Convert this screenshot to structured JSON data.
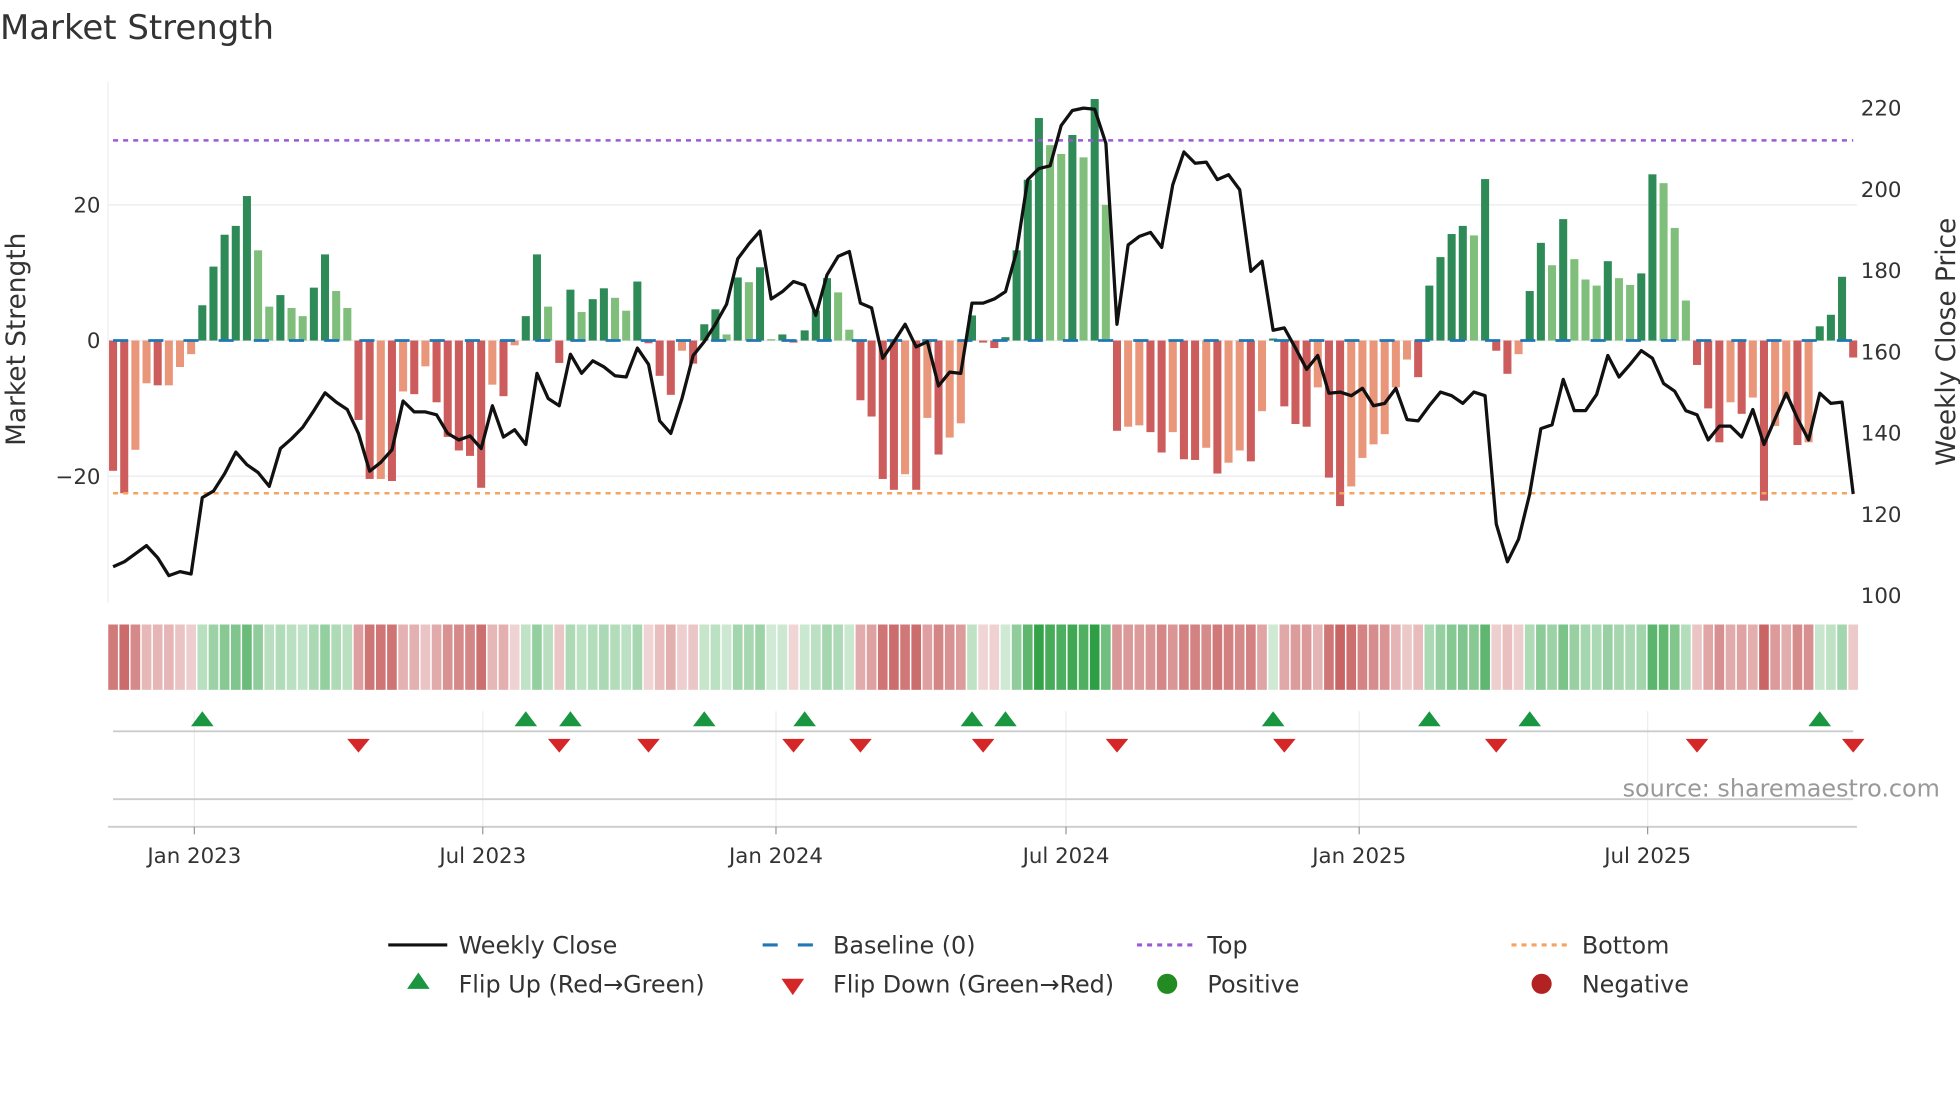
{
  "chart_data": {
    "type": "bar",
    "title": "Market Strength",
    "ylabel_left": "Market Strength",
    "ylabel_right": "Weekly Close Price",
    "source": "source: sharemaestro.com",
    "start_date": "2022-11-11",
    "frequency": "weekly",
    "left_axis": {
      "ticks": [
        20,
        0,
        -20
      ],
      "tick_labels": [
        "20",
        "0",
        "−20"
      ]
    },
    "right_axis": {
      "ticks": [
        220,
        200,
        180,
        160,
        140,
        120,
        100
      ],
      "tick_labels": [
        "220",
        "200",
        "180",
        "160",
        "140",
        "120",
        "100"
      ],
      "ylim": [
        100,
        220
      ]
    },
    "x_ticks": [
      {
        "date": "2023-01-01",
        "label": "Jan 2023"
      },
      {
        "date": "2023-07-01",
        "label": "Jul 2023"
      },
      {
        "date": "2024-01-01",
        "label": "Jan 2024"
      },
      {
        "date": "2024-07-01",
        "label": "Jul 2024"
      },
      {
        "date": "2025-01-01",
        "label": "Jan 2025"
      },
      {
        "date": "2025-07-01",
        "label": "Jul 2025"
      }
    ],
    "top_level": 29.5,
    "bottom_level": -22.5,
    "baseline": 0,
    "strength": [
      -19.2,
      -22.5,
      -16.1,
      -6.3,
      -6.6,
      -6.6,
      -3.9,
      -2,
      5.2,
      10.9,
      15.6,
      16.9,
      21.3,
      13.3,
      5,
      6.7,
      4.8,
      3.6,
      7.8,
      12.7,
      7.3,
      4.8,
      -11.7,
      -20.4,
      -20.4,
      -20.7,
      -7.5,
      -7.9,
      -3.8,
      -9.1,
      -14.2,
      -16.2,
      -17,
      -21.7,
      -6.5,
      -8.2,
      -0.7,
      3.6,
      12.7,
      5,
      -3.3,
      7.5,
      4.2,
      6.1,
      7.7,
      6.3,
      4.4,
      8.7,
      -0.4,
      -5.2,
      -8,
      -1.5,
      -3.4,
      2.4,
      4.6,
      0.9,
      9.3,
      8.6,
      10.8,
      0.2,
      0.9,
      -0.3,
      1.5,
      4.4,
      9.2,
      7.1,
      1.6,
      -8.8,
      -11.2,
      -20.4,
      -22,
      -19.7,
      -22,
      -11.4,
      -16.8,
      -14.3,
      -12.2,
      3.7,
      -0.3,
      -1.1,
      0.5,
      13.3,
      23.7,
      32.8,
      28.8,
      27.5,
      30.3,
      27,
      35.6,
      20,
      -13.3,
      -12.7,
      -12.5,
      -13.5,
      -16.5,
      -13.5,
      -17.5,
      -17.6,
      -15.8,
      -19.6,
      -18,
      -16.2,
      -17.8,
      -10.4,
      0.3,
      -9.7,
      -12.3,
      -12.7,
      -6.9,
      -20.2,
      -24.4,
      -21.5,
      -17.3,
      -15.3,
      -13.8,
      -6.9,
      -2.8,
      -5.4,
      8.1,
      12.3,
      15.7,
      16.9,
      15.5,
      23.8,
      -1.5,
      -4.9,
      -2,
      7.3,
      14.4,
      11.1,
      17.9,
      12,
      9,
      8.1,
      11.7,
      9.2,
      8.2,
      9.9,
      24.5,
      23.2,
      16.6,
      5.9,
      -3.6,
      -10,
      -15,
      -9.1,
      -10.8,
      -8.4,
      -23.6,
      -12.6,
      -8.6,
      -15.4,
      -15,
      2.1,
      3.8,
      9.4,
      -2.5
    ],
    "strength_shade": "RRrrRrrrGGGGGggGggGGggRRrRrRrRRRRRrRrGGgRGgGGggGRRRrRGGgGgGgGRGGGggRRRRrRrRrrGRRGGGGggGgGgRrrRRrRRrRrrRrGRRRrRRrrrrrrRGGGGgGRRrGGgGgggGggGGgggRRRrRrRrrRrGGGR",
    "close": [
      106.8,
      108,
      110,
      112,
      109,
      104.6,
      105.6,
      105,
      123.8,
      125.4,
      129.7,
      135,
      131.9,
      130,
      126.6,
      135.9,
      138.3,
      141.1,
      145.2,
      149.6,
      147.3,
      145.5,
      139.6,
      130.3,
      132.5,
      135.6,
      147.6,
      144.9,
      144.9,
      144.2,
      139.6,
      138,
      139,
      135.9,
      146.4,
      138.7,
      140.5,
      136.9,
      154.4,
      148.2,
      146.4,
      159.1,
      154.4,
      157.5,
      156,
      153.8,
      153.5,
      160.6,
      156.6,
      142.7,
      139.6,
      148.2,
      158.8,
      162.2,
      166.5,
      171.4,
      182.6,
      186.3,
      189.4,
      172.7,
      174.5,
      177,
      176.1,
      168.7,
      178.6,
      183.2,
      184.4,
      171.7,
      170.5,
      158.1,
      162.2,
      166.5,
      160.9,
      162.2,
      151.3,
      154.7,
      154.4,
      171.7,
      171.7,
      172.7,
      174.5,
      184.4,
      202.1,
      204.8,
      205.5,
      215.4,
      219.1,
      219.7,
      219.4,
      211,
      166.5,
      186,
      188.1,
      189.1,
      185.4,
      200.8,
      208.9,
      206.1,
      206.4,
      202.1,
      203.3,
      199.6,
      179.5,
      182,
      165,
      165.6,
      160.6,
      155.4,
      158.8,
      149.5,
      149.8,
      148.9,
      150.7,
      146.4,
      147,
      150.7,
      143,
      142.7,
      146.4,
      149.8,
      148.9,
      147,
      149.8,
      148.9,
      117.3,
      108,
      113.6,
      124.7,
      140.8,
      141.7,
      152.9,
      145.2,
      145.2,
      149.2,
      158.8,
      153.5,
      156.6,
      160,
      158.1,
      151.9,
      150,
      145.2,
      144.2,
      138,
      141.4,
      141.4,
      138.7,
      145.5,
      136.9,
      143.3,
      149.5,
      143.3,
      138,
      149.5,
      147,
      147.3,
      124.7
    ],
    "flip_up_weeks": [
      8,
      37,
      41,
      53,
      62,
      77,
      80,
      104,
      118,
      127,
      153
    ],
    "flip_down_weeks": [
      22,
      40,
      48,
      61,
      67,
      78,
      90,
      105,
      124,
      142,
      156
    ],
    "colors": {
      "positive_strong": "#2e8b57",
      "positive_weak": "#7fbf7b",
      "negative_strong": "#cd5c5c",
      "negative_weak": "#e9967a",
      "close": "#111111",
      "baseline": "#1f77b4",
      "top": "#9b59d6",
      "bottom": "#f4a460",
      "flip_up": "#1a9641",
      "flip_down": "#d62728",
      "positive_dot": "#228b22",
      "negative_dot": "#b22222"
    },
    "legend": {
      "weekly_close": "Weekly Close",
      "baseline": "Baseline (0)",
      "top": "Top",
      "bottom": "Bottom",
      "flip_up": "Flip Up (Red→Green)",
      "flip_down": "Flip Down (Green→Red)",
      "positive": "Positive",
      "negative": "Negative"
    }
  }
}
